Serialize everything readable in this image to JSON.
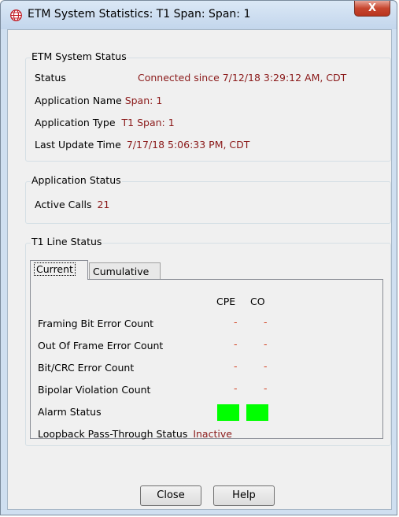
{
  "window": {
    "title": "ETM System Statistics:  T1 Span: Span: 1",
    "close_label": "X"
  },
  "etm_system_status": {
    "group_label": "ETM System Status",
    "status_label": "Status",
    "status_value": "Connected since 7/12/18 3:29:12 AM, CDT",
    "app_name_label": "Application Name",
    "app_name_value": "Span: 1",
    "app_type_label": "Application Type",
    "app_type_value": "T1 Span: 1",
    "last_update_label": "Last Update Time",
    "last_update_value": "7/17/18 5:06:33 PM, CDT"
  },
  "application_status": {
    "group_label": "Application Status",
    "active_calls_label": "Active Calls",
    "active_calls_value": "21"
  },
  "t1_line_status": {
    "group_label": "T1 Line Status",
    "tabs": [
      "Current",
      "Cumulative"
    ],
    "columns": [
      "CPE",
      "CO"
    ],
    "rows": [
      {
        "label": "Framing Bit Error Count",
        "cpe": "-",
        "co": "-"
      },
      {
        "label": "Out Of Frame Error Count",
        "cpe": "-",
        "co": "-"
      },
      {
        "label": "Bit/CRC Error Count",
        "cpe": "-",
        "co": "-"
      },
      {
        "label": "Bipolar Violation Count",
        "cpe": "-",
        "co": "-"
      }
    ],
    "alarm_label": "Alarm Status",
    "alarm_colors": {
      "cpe": "#00ff00",
      "co": "#00ff00"
    },
    "loopback_label": "Loopback Pass-Through Status",
    "loopback_value": "Inactive"
  },
  "buttons": {
    "close": "Close",
    "help": "Help"
  },
  "colors": {
    "value_text": "#8b1a1a",
    "dash": "#d23f1f",
    "alarm_ok": "#00ff00"
  }
}
